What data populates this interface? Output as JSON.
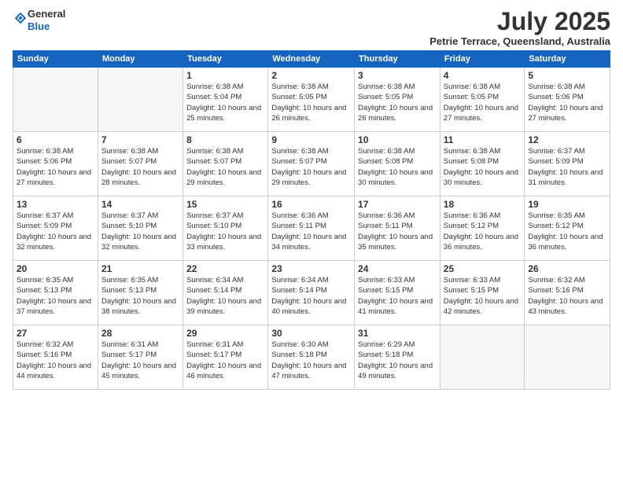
{
  "header": {
    "logo_general": "General",
    "logo_blue": "Blue",
    "month_year": "July 2025",
    "location": "Petrie Terrace, Queensland, Australia"
  },
  "days_of_week": [
    "Sunday",
    "Monday",
    "Tuesday",
    "Wednesday",
    "Thursday",
    "Friday",
    "Saturday"
  ],
  "weeks": [
    [
      {
        "day": "",
        "info": ""
      },
      {
        "day": "",
        "info": ""
      },
      {
        "day": "1",
        "info": "Sunrise: 6:38 AM\nSunset: 5:04 PM\nDaylight: 10 hours\nand 25 minutes."
      },
      {
        "day": "2",
        "info": "Sunrise: 6:38 AM\nSunset: 5:05 PM\nDaylight: 10 hours\nand 26 minutes."
      },
      {
        "day": "3",
        "info": "Sunrise: 6:38 AM\nSunset: 5:05 PM\nDaylight: 10 hours\nand 26 minutes."
      },
      {
        "day": "4",
        "info": "Sunrise: 6:38 AM\nSunset: 5:05 PM\nDaylight: 10 hours\nand 27 minutes."
      },
      {
        "day": "5",
        "info": "Sunrise: 6:38 AM\nSunset: 5:06 PM\nDaylight: 10 hours\nand 27 minutes."
      }
    ],
    [
      {
        "day": "6",
        "info": "Sunrise: 6:38 AM\nSunset: 5:06 PM\nDaylight: 10 hours\nand 27 minutes."
      },
      {
        "day": "7",
        "info": "Sunrise: 6:38 AM\nSunset: 5:07 PM\nDaylight: 10 hours\nand 28 minutes."
      },
      {
        "day": "8",
        "info": "Sunrise: 6:38 AM\nSunset: 5:07 PM\nDaylight: 10 hours\nand 29 minutes."
      },
      {
        "day": "9",
        "info": "Sunrise: 6:38 AM\nSunset: 5:07 PM\nDaylight: 10 hours\nand 29 minutes."
      },
      {
        "day": "10",
        "info": "Sunrise: 6:38 AM\nSunset: 5:08 PM\nDaylight: 10 hours\nand 30 minutes."
      },
      {
        "day": "11",
        "info": "Sunrise: 6:38 AM\nSunset: 5:08 PM\nDaylight: 10 hours\nand 30 minutes."
      },
      {
        "day": "12",
        "info": "Sunrise: 6:37 AM\nSunset: 5:09 PM\nDaylight: 10 hours\nand 31 minutes."
      }
    ],
    [
      {
        "day": "13",
        "info": "Sunrise: 6:37 AM\nSunset: 5:09 PM\nDaylight: 10 hours\nand 32 minutes."
      },
      {
        "day": "14",
        "info": "Sunrise: 6:37 AM\nSunset: 5:10 PM\nDaylight: 10 hours\nand 32 minutes."
      },
      {
        "day": "15",
        "info": "Sunrise: 6:37 AM\nSunset: 5:10 PM\nDaylight: 10 hours\nand 33 minutes."
      },
      {
        "day": "16",
        "info": "Sunrise: 6:36 AM\nSunset: 5:11 PM\nDaylight: 10 hours\nand 34 minutes."
      },
      {
        "day": "17",
        "info": "Sunrise: 6:36 AM\nSunset: 5:11 PM\nDaylight: 10 hours\nand 35 minutes."
      },
      {
        "day": "18",
        "info": "Sunrise: 6:36 AM\nSunset: 5:12 PM\nDaylight: 10 hours\nand 36 minutes."
      },
      {
        "day": "19",
        "info": "Sunrise: 6:35 AM\nSunset: 5:12 PM\nDaylight: 10 hours\nand 36 minutes."
      }
    ],
    [
      {
        "day": "20",
        "info": "Sunrise: 6:35 AM\nSunset: 5:13 PM\nDaylight: 10 hours\nand 37 minutes."
      },
      {
        "day": "21",
        "info": "Sunrise: 6:35 AM\nSunset: 5:13 PM\nDaylight: 10 hours\nand 38 minutes."
      },
      {
        "day": "22",
        "info": "Sunrise: 6:34 AM\nSunset: 5:14 PM\nDaylight: 10 hours\nand 39 minutes."
      },
      {
        "day": "23",
        "info": "Sunrise: 6:34 AM\nSunset: 5:14 PM\nDaylight: 10 hours\nand 40 minutes."
      },
      {
        "day": "24",
        "info": "Sunrise: 6:33 AM\nSunset: 5:15 PM\nDaylight: 10 hours\nand 41 minutes."
      },
      {
        "day": "25",
        "info": "Sunrise: 6:33 AM\nSunset: 5:15 PM\nDaylight: 10 hours\nand 42 minutes."
      },
      {
        "day": "26",
        "info": "Sunrise: 6:32 AM\nSunset: 5:16 PM\nDaylight: 10 hours\nand 43 minutes."
      }
    ],
    [
      {
        "day": "27",
        "info": "Sunrise: 6:32 AM\nSunset: 5:16 PM\nDaylight: 10 hours\nand 44 minutes."
      },
      {
        "day": "28",
        "info": "Sunrise: 6:31 AM\nSunset: 5:17 PM\nDaylight: 10 hours\nand 45 minutes."
      },
      {
        "day": "29",
        "info": "Sunrise: 6:31 AM\nSunset: 5:17 PM\nDaylight: 10 hours\nand 46 minutes."
      },
      {
        "day": "30",
        "info": "Sunrise: 6:30 AM\nSunset: 5:18 PM\nDaylight: 10 hours\nand 47 minutes."
      },
      {
        "day": "31",
        "info": "Sunrise: 6:29 AM\nSunset: 5:18 PM\nDaylight: 10 hours\nand 49 minutes."
      },
      {
        "day": "",
        "info": ""
      },
      {
        "day": "",
        "info": ""
      }
    ]
  ]
}
